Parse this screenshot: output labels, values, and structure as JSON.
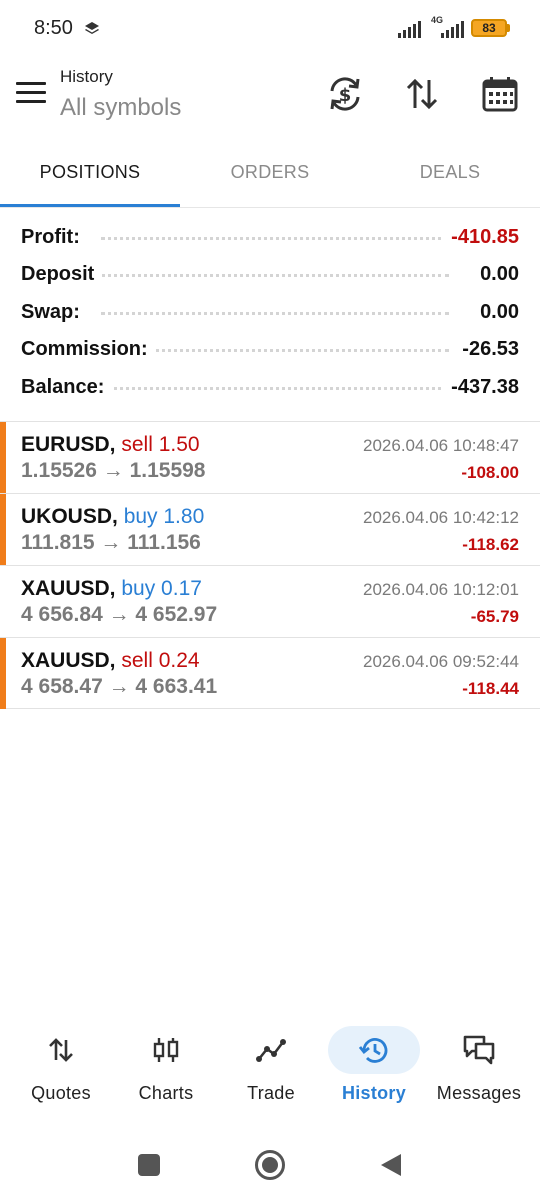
{
  "status_bar": {
    "time": "8:50",
    "network": "4G",
    "battery": "83"
  },
  "header": {
    "title": "History",
    "subtitle": "All symbols",
    "icons": [
      "currency-exchange-icon",
      "sort-icon",
      "calendar-icon"
    ]
  },
  "tabs": [
    {
      "label": "POSITIONS",
      "active": true
    },
    {
      "label": "ORDERS",
      "active": false
    },
    {
      "label": "DEALS",
      "active": false
    }
  ],
  "summary": [
    {
      "label": "Profit:",
      "value": "-410.85"
    },
    {
      "label": "Deposit",
      "value": "0.00"
    },
    {
      "label": "Swap:",
      "value": "0.00"
    },
    {
      "label": "Commission:",
      "value": "-26.53"
    },
    {
      "label": "Balance:",
      "value": "-437.38"
    }
  ],
  "deals": [
    {
      "symbol": "EURUSD,",
      "side": "sell 1.50",
      "prices": "1.15526 → 1.15598",
      "time": "2026.04.06 10:48:47",
      "profit": "-108.00"
    },
    {
      "symbol": "UKOUSD,",
      "side": "buy 1.80",
      "prices": "111.815 → 111.156",
      "time": "2026.04.06 10:42:12",
      "profit": "-118.62"
    },
    {
      "symbol": "XAUUSD,",
      "side": "buy 0.17",
      "prices": "4 656.84 → 4 652.97",
      "time": "2026.04.06 10:12:01",
      "profit": "-65.79"
    },
    {
      "symbol": "XAUUSD,",
      "side": "sell 0.24",
      "prices": "4 658.47 → 4 663.41",
      "time": "2026.04.06 09:52:44",
      "profit": "-118.44"
    }
  ],
  "bottom_nav": [
    {
      "label": "Quotes",
      "icon": "quotes-icon",
      "active": false
    },
    {
      "label": "Charts",
      "icon": "charts-icon",
      "active": false
    },
    {
      "label": "Trade",
      "icon": "trade-icon",
      "active": false
    },
    {
      "label": "History",
      "icon": "history-icon",
      "active": true
    },
    {
      "label": "Messages",
      "icon": "messages-icon",
      "active": false
    }
  ],
  "colors": {
    "accent": "#2a7fd4",
    "negative": "#c10d0d",
    "sell_stripe": "#f07d1a"
  }
}
